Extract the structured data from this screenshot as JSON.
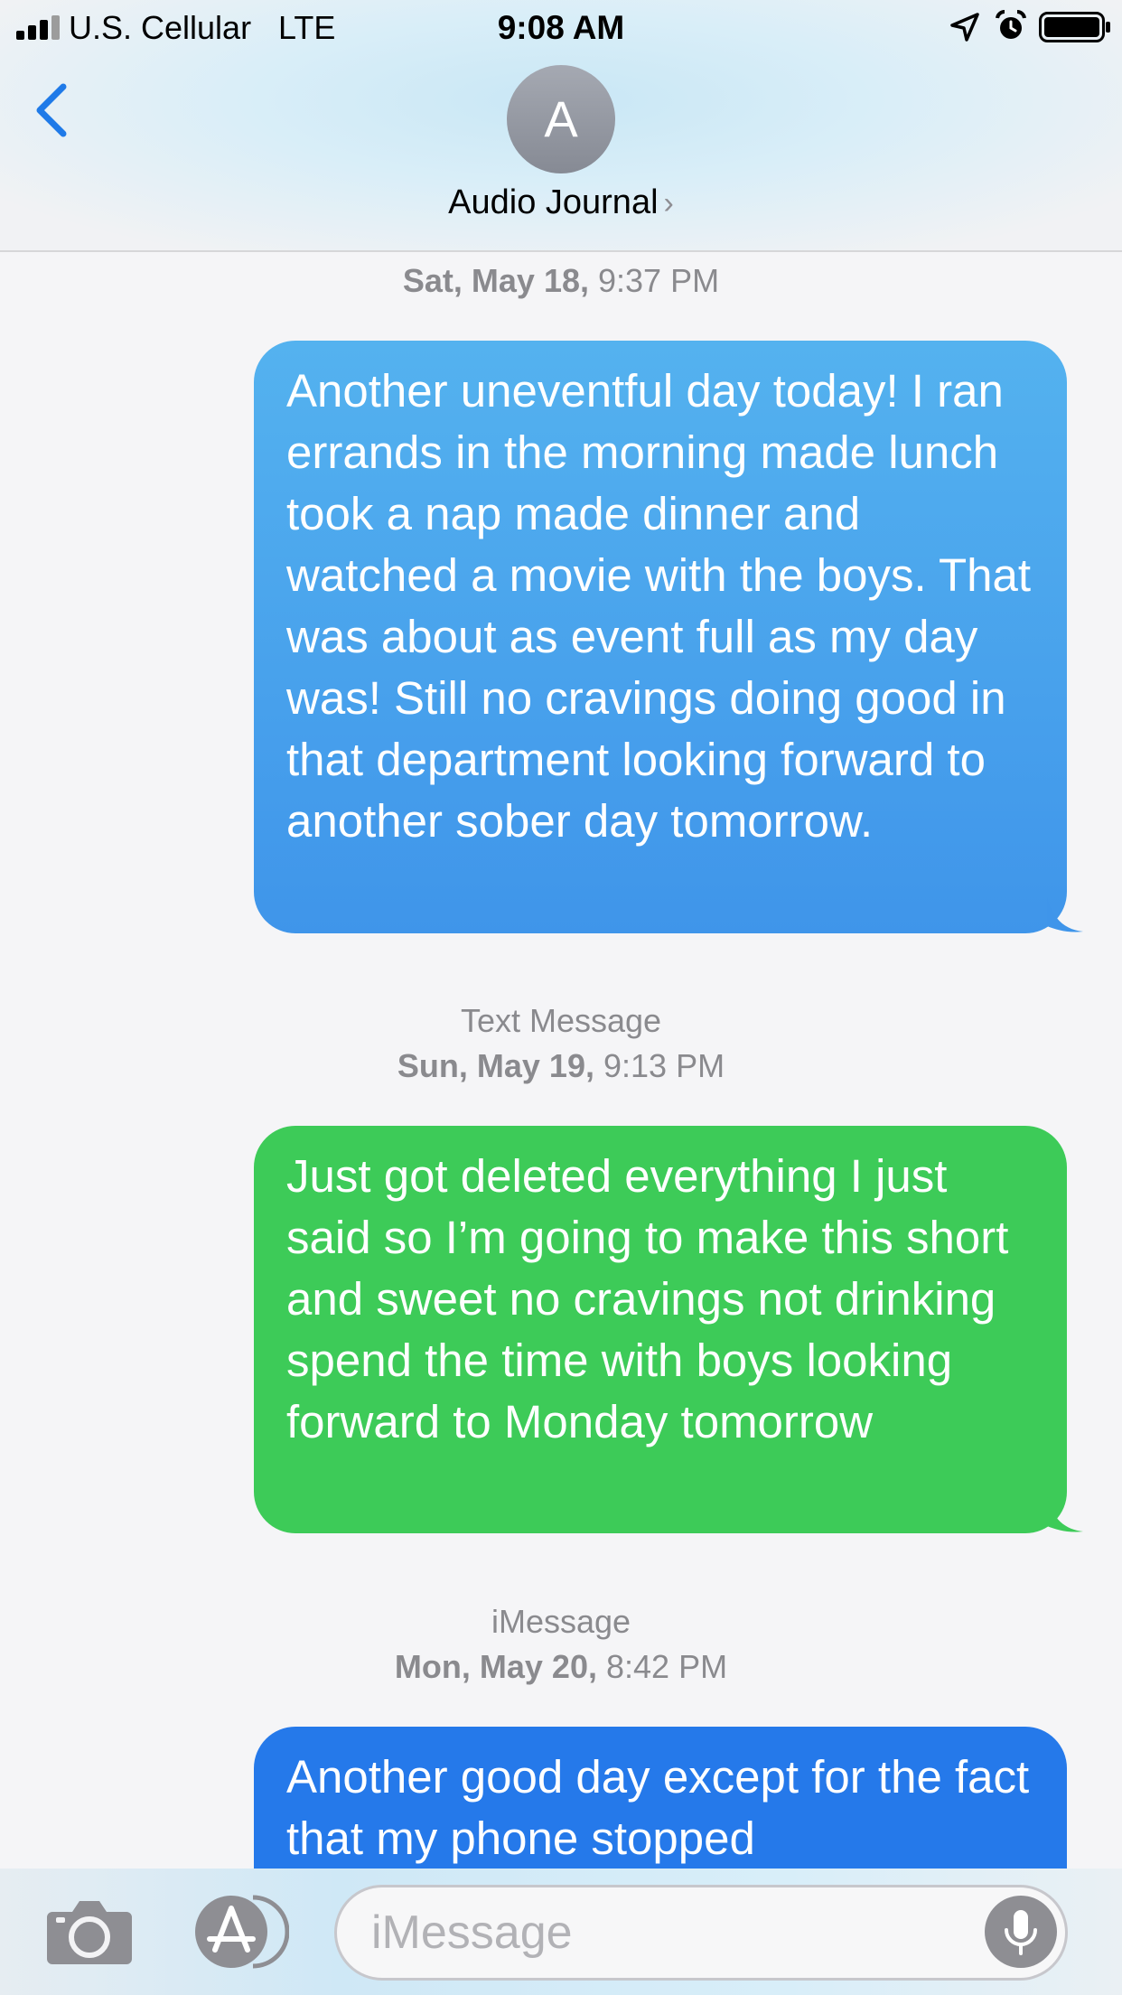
{
  "status_bar": {
    "carrier": "U.S. Cellular",
    "network": "LTE",
    "time": "9:08 AM"
  },
  "header": {
    "avatar_initial": "A",
    "contact_name": "Audio Journal",
    "contact_chevron": "›"
  },
  "conversation": {
    "blocks": [
      {
        "service": "",
        "date": "Sat, May 18,",
        "time": "9:37 PM",
        "message": "Another uneventful day today! I ran errands in the morning made lunch took a nap made dinner and watched a movie with the boys. That was about as event full as my day was! Still no cravings doing good in that department looking forward to another sober day tomorrow.",
        "color": "#4aa3ed"
      },
      {
        "service": "Text Message",
        "date": "Sun, May 19,",
        "time": "9:13 PM",
        "message": "Just got deleted everything I just said so I’m going to make this short and sweet no cravings not drinking spend the time with boys looking forward to Monday tomorrow",
        "color": "#3dcb58"
      },
      {
        "service": "iMessage",
        "date": "Mon, May 20,",
        "time": "8:42 PM",
        "message": "Another good day except for the fact that my phone stopped",
        "color": "#2579ea"
      }
    ]
  },
  "input_bar": {
    "placeholder": "iMessage"
  },
  "icons": {
    "back": "chevron-left-icon",
    "location": "location-arrow-icon",
    "alarm": "alarm-clock-icon",
    "battery": "battery-icon",
    "camera": "camera-icon",
    "app_store": "app-store-icon",
    "mic": "microphone-icon"
  },
  "colors": {
    "accent": "#1f7ae8",
    "timestamp": "#8a8a8e"
  }
}
